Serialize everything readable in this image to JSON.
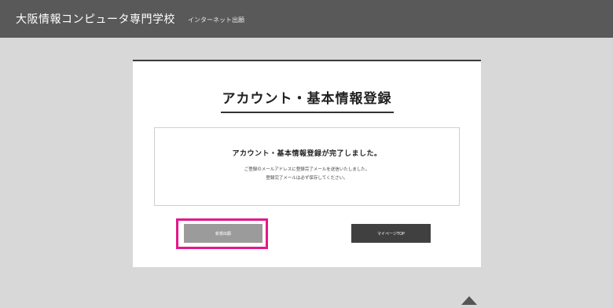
{
  "header": {
    "school_name": "大阪情報コンピュータ専門学校",
    "subtitle": "インターネット出願"
  },
  "card": {
    "title": "アカウント・基本情報登録",
    "message": {
      "heading": "アカウント・基本情報登録が完了しました。",
      "line1": "ご登録のメールアドレスに登録完了メールを送信いたしました。",
      "line2": "登録完了メールは必ず保存してください。"
    },
    "buttons": {
      "apply_label": "新規出願",
      "mypage_label": "マイページTOP"
    }
  },
  "icons": {
    "scroll_top": "chevron-up-icon"
  },
  "colors": {
    "header_bg": "#595959",
    "page_bg": "#d8d8d8",
    "highlight": "#e4178c",
    "apply_button": "#9b9b9b",
    "mypage_button": "#404040"
  }
}
